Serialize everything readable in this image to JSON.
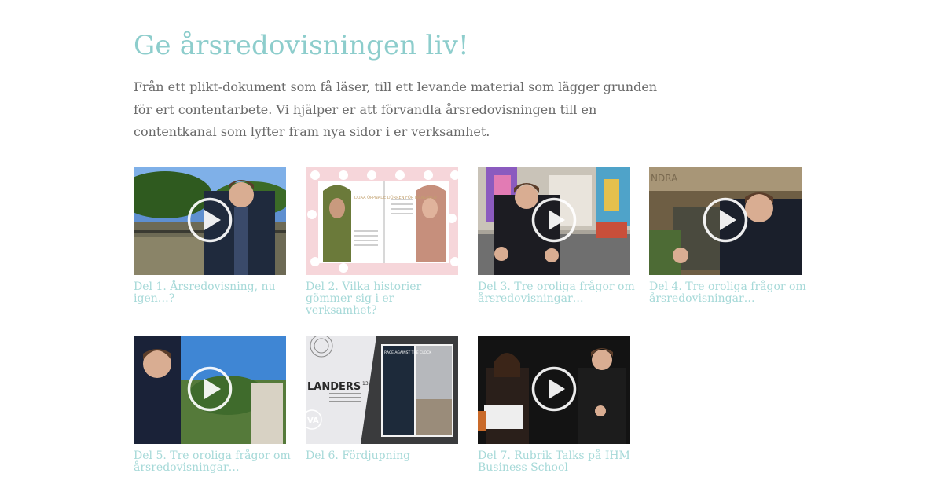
{
  "page": {
    "heading": "Ge årsredovisningen liv!",
    "intro": "Från ett plikt-dokument som få läser, till ett levande material som lägger grunden för ert contentarbete. Vi hjälper er att förvandla årsredovisningen till en contentkanal som lyfter fram nya sidor i er verksamhet."
  },
  "colors": {
    "heading": "#8dcdcc",
    "caption": "#a6d9d8",
    "body_text": "#6a6a6a"
  },
  "videos": [
    {
      "caption": "Del 1. Årsredovisning, nu igen…?",
      "icon": "play-icon"
    },
    {
      "caption": "Del 2. Vilka historier gömmer sig i er verksamhet?",
      "icon": "play-icon"
    },
    {
      "caption": "Del 3. Tre oroliga frågor om årsredovisningar…",
      "icon": "play-icon"
    },
    {
      "caption": "Del 4. Tre oroliga frågor om årsredovisningar…",
      "icon": "play-icon"
    },
    {
      "caption": "Del 5. Tre oroliga frågor om årsredovisningar…",
      "icon": "play-icon"
    },
    {
      "caption": "Del 6. Fördjupning",
      "icon": null
    },
    {
      "caption": "Del 7. Rubrik Talks på IHM Business School",
      "icon": "play-icon"
    }
  ],
  "thumbnail_text": {
    "v2_magazine_headline": "DUAA ÖPPNADE DÖRREN FÖR MÅNGFALD",
    "v6_cover_title": "LANDERS",
    "v6_cover_number": "13",
    "v6_spread_title": "RACE AGAINST THE CLOCK",
    "v6_logo": "VA",
    "v4_sign": "NDRA"
  }
}
